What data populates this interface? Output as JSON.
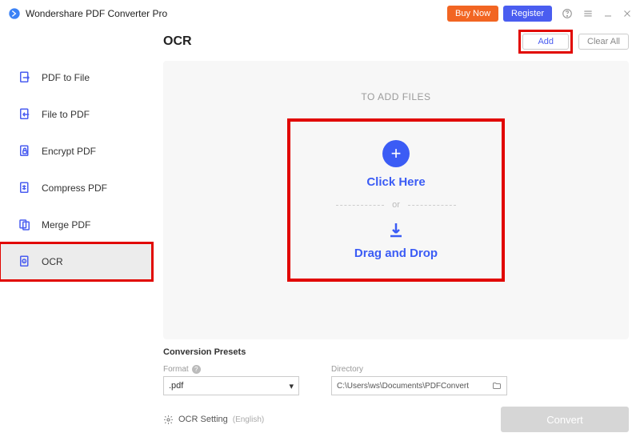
{
  "titlebar": {
    "app_name": "Wondershare PDF Converter Pro",
    "buy_now": "Buy Now",
    "register": "Register"
  },
  "sidebar": {
    "items": [
      {
        "label": "PDF to File"
      },
      {
        "label": "File to PDF"
      },
      {
        "label": "Encrypt PDF"
      },
      {
        "label": "Compress PDF"
      },
      {
        "label": "Merge PDF"
      },
      {
        "label": "OCR"
      }
    ]
  },
  "header": {
    "title": "OCR",
    "add": "Add",
    "clear_all": "Clear All"
  },
  "panel": {
    "to_add": "TO ADD FILES",
    "click_here": "Click Here",
    "or": "or",
    "drag_drop": "Drag and Drop"
  },
  "presets": {
    "title": "Conversion Presets",
    "format_label": "Format",
    "format_value": ".pdf",
    "directory_label": "Directory",
    "directory_value": "C:\\Users\\ws\\Documents\\PDFConvert",
    "ocr_setting": "OCR Setting",
    "ocr_lang": "(English)",
    "convert": "Convert"
  }
}
